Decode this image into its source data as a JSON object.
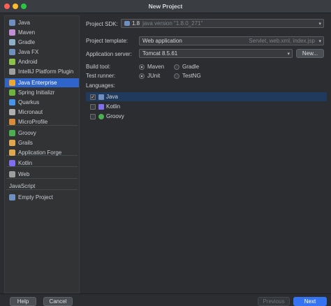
{
  "window": {
    "title": "New Project"
  },
  "sidebar": {
    "items": [
      {
        "label": "Java",
        "icon": "folder-icon",
        "color": "#6f8fbf"
      },
      {
        "label": "Maven",
        "icon": "maven-icon",
        "color": "#c28fd6"
      },
      {
        "label": "Gradle",
        "icon": "gradle-icon",
        "color": "#8fb0c9"
      },
      {
        "label": "Java FX",
        "icon": "folder-icon",
        "color": "#6f8fbf"
      },
      {
        "label": "Android",
        "icon": "android-icon",
        "color": "#8bc34a"
      },
      {
        "label": "IntelliJ Platform Plugin",
        "icon": "plugin-icon",
        "color": "#9e9e9e"
      },
      {
        "label": "Java Enterprise",
        "icon": "java-enterprise-icon",
        "color": "#f0a732",
        "selected": true
      },
      {
        "label": "Spring Initializr",
        "icon": "spring-icon",
        "color": "#6db33f"
      },
      {
        "label": "Quarkus",
        "icon": "quarkus-icon",
        "color": "#4695eb"
      },
      {
        "label": "Micronaut",
        "icon": "micronaut-icon",
        "color": "#b0b0b0"
      },
      {
        "label": "MicroProfile",
        "icon": "microprofile-icon",
        "color": "#d98b3a"
      },
      {
        "label": "Groovy",
        "icon": "groovy-icon",
        "color": "#4caf50"
      },
      {
        "label": "Grails",
        "icon": "grails-icon",
        "color": "#e0a84e"
      },
      {
        "label": "Application Forge",
        "icon": "forge-icon",
        "color": "#e0a84e"
      },
      {
        "label": "Kotlin",
        "icon": "kotlin-icon",
        "color": "#7f6df2"
      },
      {
        "label": "Web",
        "icon": "globe-icon",
        "color": "#9e9e9e"
      },
      {
        "label": "JavaScript",
        "icon": "",
        "color": ""
      },
      {
        "label": "Empty Project",
        "icon": "folder-icon",
        "color": "#6f8fbf"
      }
    ]
  },
  "form": {
    "sdk_label": "Project SDK:",
    "sdk_value": "1.8",
    "sdk_detail": "java version \"1.8.0_271\"",
    "template_label": "Project template:",
    "template_value": "Web application",
    "template_detail": "Servlet, web.xml, index.jsp",
    "server_label": "Application server:",
    "server_value": "Tomcat 8.5.61",
    "new_button": "New...",
    "build_label": "Build tool:",
    "build_options": [
      "Maven",
      "Gradle"
    ],
    "build_selected": "Maven",
    "test_label": "Test runner:",
    "test_options": [
      "JUnit",
      "TestNG"
    ],
    "test_selected": "JUnit",
    "languages_label": "Languages:",
    "languages": [
      {
        "label": "Java",
        "checked": true,
        "selected": true,
        "icon": "folder-icon",
        "color": "#6f8fbf"
      },
      {
        "label": "Kotlin",
        "checked": false,
        "selected": false,
        "icon": "kotlin-icon",
        "color": "#7f6df2"
      },
      {
        "label": "Groovy",
        "checked": false,
        "selected": false,
        "icon": "groovy-icon",
        "color": "#4caf50"
      }
    ]
  },
  "footer": {
    "help": "Help",
    "cancel": "Cancel",
    "previous": "Previous",
    "next": "Next"
  }
}
